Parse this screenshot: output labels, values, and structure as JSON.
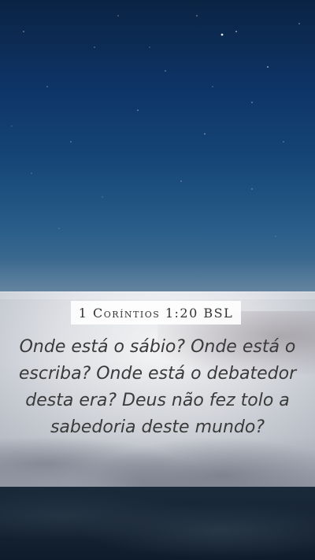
{
  "reference": "1 Coríntios 1:20 BSL",
  "verse": "Onde está o sábio? Onde está o escriba? Onde está o debatedor desta era? Deus não fez tolo a sabedoria deste mundo?"
}
